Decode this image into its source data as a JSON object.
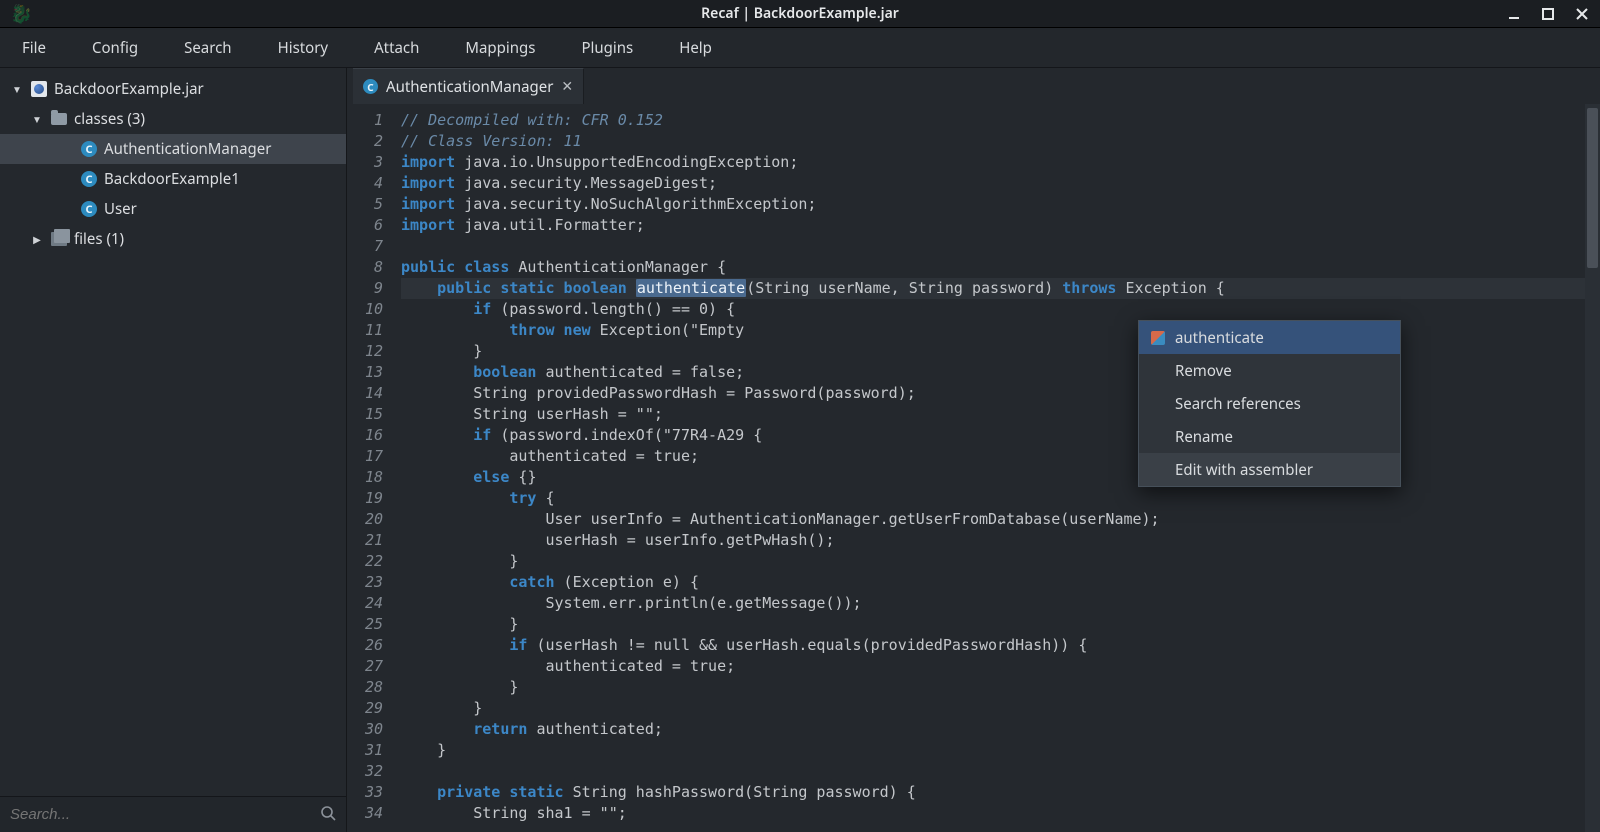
{
  "window": {
    "title": "Recaf | BackdoorExample.jar"
  },
  "menu": {
    "file": "File",
    "config": "Config",
    "search": "Search",
    "history": "History",
    "attach": "Attach",
    "mappings": "Mappings",
    "plugins": "Plugins",
    "help": "Help"
  },
  "sidebar": {
    "root": "BackdoorExample.jar",
    "classes_label": "classes (3)",
    "items": {
      "auth": "AuthenticationManager",
      "backdoor": "BackdoorExample1",
      "user": "User"
    },
    "files_label": "files (1)",
    "search_placeholder": "Search..."
  },
  "tabs": {
    "auth": "AuthenticationManager"
  },
  "context_menu": {
    "authenticate": "authenticate",
    "remove": "Remove",
    "search_refs": "Search references",
    "rename": "Rename",
    "edit_asm": "Edit with assembler"
  },
  "code": {
    "selected_word": "authenticate",
    "lines": [
      {
        "n": 1,
        "pre": "",
        "t": "// Decompiled with: CFR 0.152",
        "cls": "cm"
      },
      {
        "n": 2,
        "pre": "",
        "t": "// Class Version: 11",
        "cls": "cm"
      },
      {
        "n": 3,
        "pre": "",
        "kw": "import",
        "rest": " java.io.UnsupportedEncodingException;"
      },
      {
        "n": 4,
        "pre": "",
        "kw": "import",
        "rest": " java.security.MessageDigest;"
      },
      {
        "n": 5,
        "pre": "",
        "kw": "import",
        "rest": " java.security.NoSuchAlgorithmException;"
      },
      {
        "n": 6,
        "pre": "",
        "kw": "import",
        "rest": " java.util.Formatter;"
      },
      {
        "n": 7,
        "pre": "",
        "t": ""
      },
      {
        "n": 8,
        "pre": "",
        "kw": "public class",
        "rest": " AuthenticationManager {"
      },
      {
        "n": 9,
        "pre": "    ",
        "kw": "public static boolean",
        "sel": "authenticate",
        "mid": "(String userName, String password) ",
        "kw2": "throws",
        "rest2": " Exception {",
        "hl": true
      },
      {
        "n": 10,
        "pre": "        ",
        "kw": "if",
        "rest": " (password.length() == 0) {"
      },
      {
        "n": 11,
        "pre": "            ",
        "kw": "throw new",
        "rest": " Exception(\"Empty"
      },
      {
        "n": 12,
        "pre": "        ",
        "t": "}"
      },
      {
        "n": 13,
        "pre": "        ",
        "kw": "boolean",
        "rest": " authenticated = false;"
      },
      {
        "n": 14,
        "pre": "        ",
        "t": "String providedPasswordHash = ",
        "tail": "Password(password);"
      },
      {
        "n": 15,
        "pre": "        ",
        "t": "String userHash = \"\";"
      },
      {
        "n": 16,
        "pre": "        ",
        "kw": "if",
        "rest": " (password.indexOf(\"77R4-A29",
        "tail": " {"
      },
      {
        "n": 17,
        "pre": "            ",
        "t": "authenticated = true;"
      },
      {
        "n": 18,
        "pre": "        ",
        "t": "} ",
        "kw": "else",
        "rest": " {"
      },
      {
        "n": 19,
        "pre": "            ",
        "kw": "try",
        "rest": " {"
      },
      {
        "n": 20,
        "pre": "                ",
        "t": "User userInfo = AuthenticationManager.getUserFromDatabase(userName);"
      },
      {
        "n": 21,
        "pre": "                ",
        "t": "userHash = userInfo.getPwHash();"
      },
      {
        "n": 22,
        "pre": "            ",
        "t": "}"
      },
      {
        "n": 23,
        "pre": "            ",
        "kw": "catch",
        "rest": " (Exception e) {"
      },
      {
        "n": 24,
        "pre": "                ",
        "t": "System.err.println(e.getMessage());"
      },
      {
        "n": 25,
        "pre": "            ",
        "t": "}"
      },
      {
        "n": 26,
        "pre": "            ",
        "kw": "if",
        "rest": " (userHash != null && userHash.equals(providedPasswordHash)) {"
      },
      {
        "n": 27,
        "pre": "                ",
        "t": "authenticated = true;"
      },
      {
        "n": 28,
        "pre": "            ",
        "t": "}"
      },
      {
        "n": 29,
        "pre": "        ",
        "t": "}"
      },
      {
        "n": 30,
        "pre": "        ",
        "kw": "return",
        "rest": " authenticated;"
      },
      {
        "n": 31,
        "pre": "    ",
        "t": "}"
      },
      {
        "n": 32,
        "pre": "",
        "t": ""
      },
      {
        "n": 33,
        "pre": "    ",
        "kw": "private static",
        "rest": " String hashPassword(String password) {"
      },
      {
        "n": 34,
        "pre": "        ",
        "t": "String sha1 = \"\";"
      }
    ]
  }
}
